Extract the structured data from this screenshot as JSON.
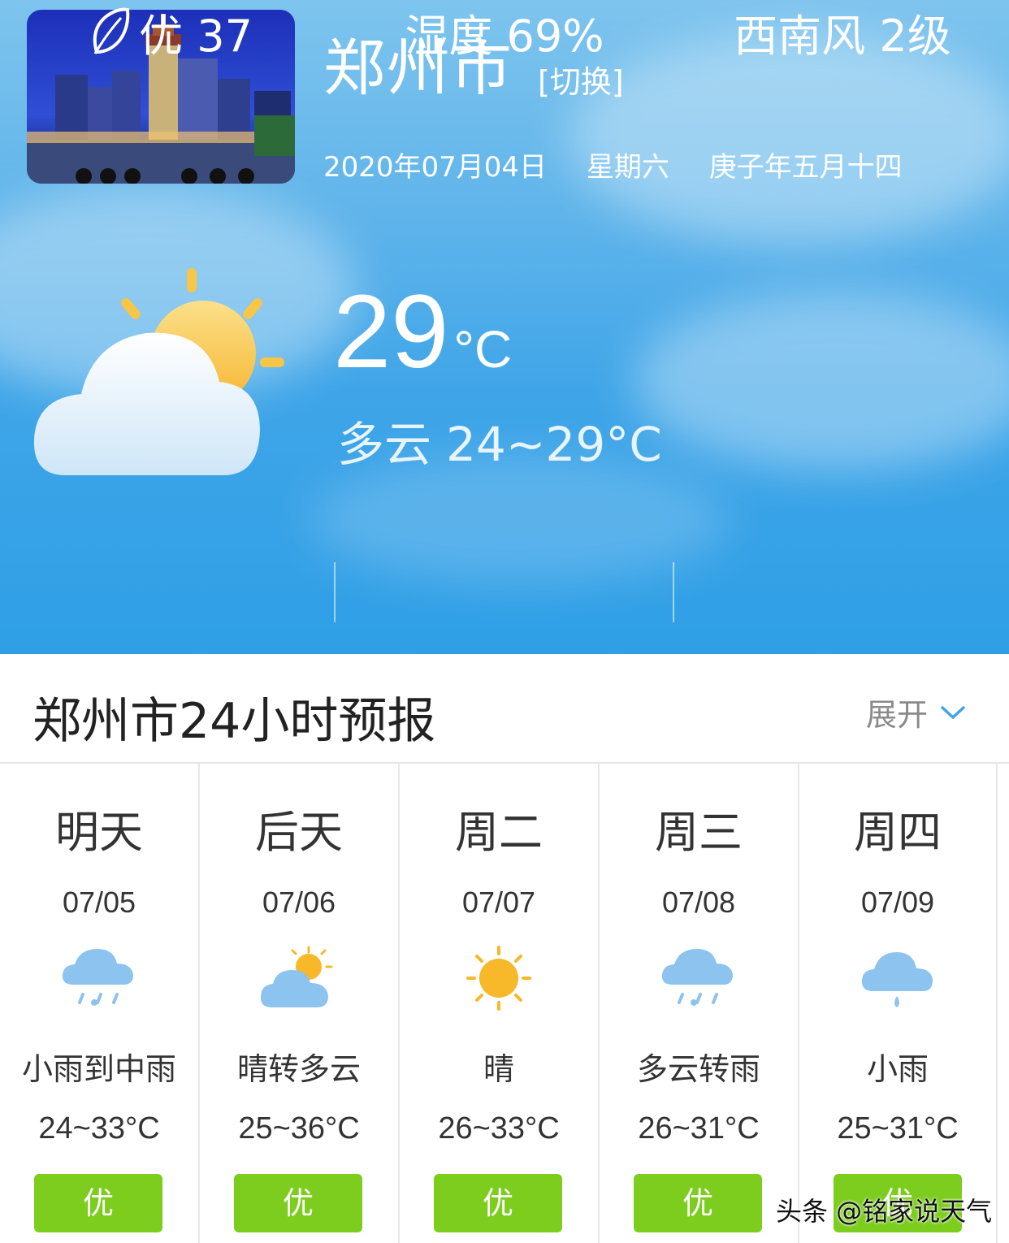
{
  "header": {
    "city": "郑州市",
    "switch_label": "[切换]",
    "date": "2020年07月04日",
    "weekday": "星期六",
    "lunar_date": "庚子年五月十四"
  },
  "current": {
    "temperature": "29",
    "unit": "°C",
    "condition": "多云",
    "range": "24~29°C",
    "icon": "partly-cloudy-icon"
  },
  "stats": {
    "aqi_label": "优 37",
    "humidity": "湿度 69%",
    "wind": "西南风 2级"
  },
  "forecast": {
    "title": "郑州市24小时预报",
    "expand_label": "展开",
    "days": [
      {
        "name": "明天",
        "date": "07/05",
        "condition": "小雨到中雨",
        "temp": "24~33°C",
        "aqi": "优",
        "icon": "rain-cloud-icon"
      },
      {
        "name": "后天",
        "date": "07/06",
        "condition": "晴转多云",
        "temp": "25~36°C",
        "aqi": "优",
        "icon": "partly-cloudy-icon"
      },
      {
        "name": "周二",
        "date": "07/07",
        "condition": "晴",
        "temp": "26~33°C",
        "aqi": "优",
        "icon": "sun-icon"
      },
      {
        "name": "周三",
        "date": "07/08",
        "condition": "多云转雨",
        "temp": "26~31°C",
        "aqi": "优",
        "icon": "rain-cloud-icon"
      },
      {
        "name": "周四",
        "date": "07/09",
        "condition": "小雨",
        "temp": "25~31°C",
        "aqi": "优",
        "icon": "light-rain-icon"
      }
    ]
  },
  "watermark": "头条 @铭家说天气",
  "colors": {
    "sky": "#3fa5e8",
    "aqi_good": "#7ccd1e",
    "sun": "#f7b829"
  }
}
